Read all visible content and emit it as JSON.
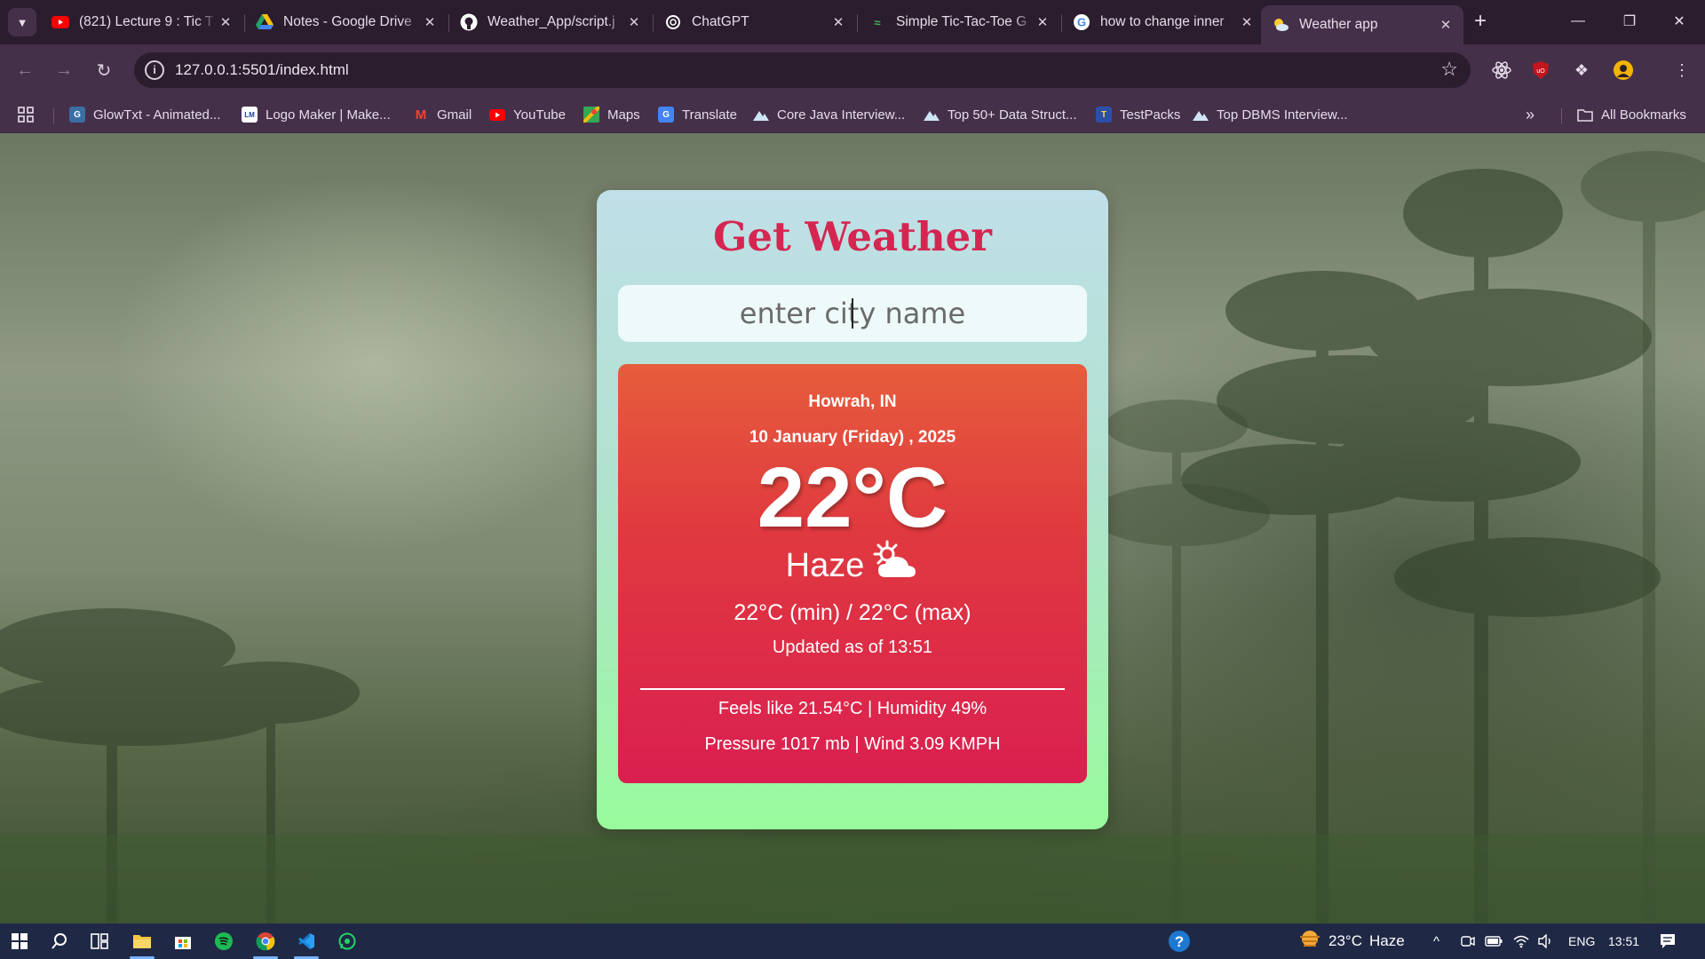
{
  "browser": {
    "tabs": [
      {
        "title": "(821) Lecture 9 : Tic T",
        "icon": "youtube-icon"
      },
      {
        "title": "Notes - Google Drive",
        "icon": "google-drive-icon"
      },
      {
        "title": "Weather_App/script.j",
        "icon": "github-icon"
      },
      {
        "title": "ChatGPT",
        "icon": "chatgpt-icon"
      },
      {
        "title": "Simple Tic-Tac-Toe G",
        "icon": "codepen-icon"
      },
      {
        "title": "how to change inner",
        "icon": "google-icon"
      },
      {
        "title": "Weather app",
        "icon": "weather-icon",
        "active": true
      }
    ],
    "url": "127.0.0.1:5501/index.html",
    "bookmarks": [
      {
        "label": "GlowTxt - Animated...",
        "icon": "glowtxt-icon"
      },
      {
        "label": "Logo Maker | Make...",
        "icon": "logo-maker-icon"
      },
      {
        "label": "Gmail",
        "icon": "gmail-icon"
      },
      {
        "label": "YouTube",
        "icon": "youtube-icon"
      },
      {
        "label": "Maps",
        "icon": "maps-icon"
      },
      {
        "label": "Translate",
        "icon": "translate-icon"
      },
      {
        "label": "Core Java Interview...",
        "icon": "mountain-icon"
      },
      {
        "label": "Top 50+ Data Struct...",
        "icon": "mountain-icon"
      },
      {
        "label": "TestPacks",
        "icon": "testpacks-icon"
      },
      {
        "label": "Top DBMS Interview...",
        "icon": "mountain-icon"
      }
    ],
    "all_bookmarks": "All Bookmarks"
  },
  "app": {
    "heading": "Get Weather",
    "search_placeholder": "enter city name",
    "weather": {
      "location": "Howrah, IN",
      "date": "10 January (Friday) , 2025",
      "temperature": "22°C",
      "condition": "Haze",
      "condition_icon": "sun-cloud-icon",
      "min_max": "22°C (min) / 22°C (max)",
      "updated": "Updated as of 13:51",
      "feels_humidity": "Feels like 21.54°C | Humidity 49%",
      "pressure_wind": "Pressure 1017 mb | Wind 3.09 KMPH"
    },
    "colors": {
      "heading": "#d52652",
      "panel_top": "#e65d3c",
      "panel_bottom": "#da1f50"
    }
  },
  "taskbar": {
    "weather_temp": "23°C",
    "weather_text": "Haze",
    "language": "ENG",
    "time": "13:51"
  }
}
